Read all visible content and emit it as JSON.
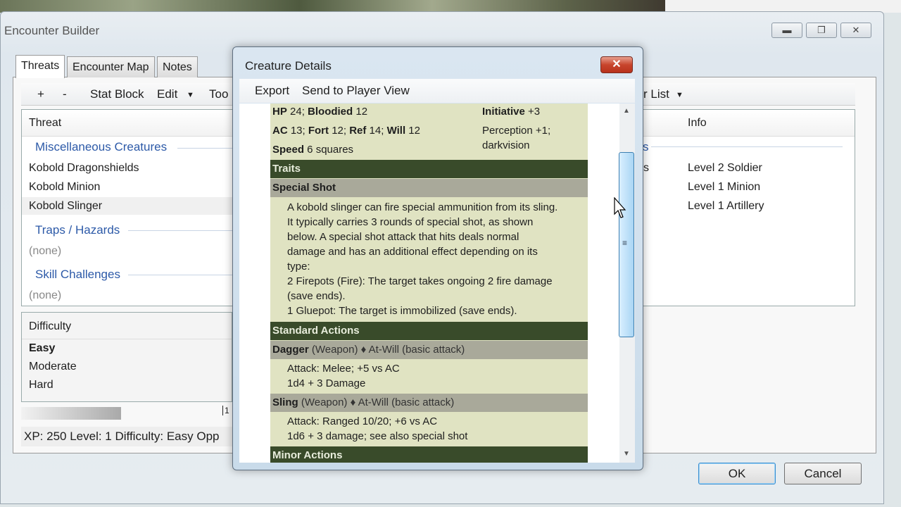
{
  "main_window": {
    "title": "Encounter Builder",
    "min": "▬",
    "max": "❐",
    "close": "✕"
  },
  "tabs": [
    "Threats",
    "Encounter Map",
    "Notes"
  ],
  "toolbar": {
    "add": "+",
    "remove": "-",
    "stat_block": "Stat Block",
    "edit": "Edit",
    "tools": "Too",
    "list": "r List"
  },
  "list": {
    "columns": [
      "Threat",
      "Info"
    ],
    "groups": [
      {
        "name": "Miscellaneous Creatures",
        "suffix": "s"
      },
      {
        "name": "Traps / Hazards"
      },
      {
        "name": "Skill Challenges"
      }
    ],
    "rows": [
      {
        "name": "Kobold Dragonshields",
        "suffix": "s",
        "info": "Level 2 Soldier"
      },
      {
        "name": "Kobold Minion",
        "info": "Level 1 Minion"
      },
      {
        "name": "Kobold Slinger",
        "info": "Level 1 Artillery"
      }
    ],
    "none": "(none)"
  },
  "difficulty": {
    "header": "Difficulty",
    "options": [
      "Easy",
      "Moderate",
      "Hard"
    ],
    "selected": "Easy",
    "marker": "1"
  },
  "status": "XP: 250   Level: 1   Difficulty: Easy   Opp",
  "buttons": {
    "ok": "OK",
    "cancel": "Cancel"
  },
  "dialog": {
    "title": "Creature Details",
    "close": "✕",
    "export": "Export",
    "send": "Send to Player View",
    "stats": {
      "hp_l": "HP",
      "hp": " 24; ",
      "bl_l": "Bloodied",
      "bl": " 12",
      "ac_l": "AC",
      "ac": " 13; ",
      "fort_l": "Fort",
      "fort": " 12; ",
      "ref_l": "Ref",
      "ref": " 14; ",
      "will_l": "Will",
      "will": " 12",
      "speed_l": "Speed",
      "speed": " 6 squares",
      "init_l": "Initiative",
      "init": " +3",
      "perception": "Perception +1; darkvision"
    },
    "traits": "Traits",
    "special_shot": "Special Shot",
    "special_text": [
      "A kobold slinger can fire special ammunition from its sling.",
      "It typically carries 3 rounds of special shot, as shown",
      "below. A special shot attack that hits deals normal",
      "damage and has an additional effect depending on its",
      "type:",
      "2 Firepots (Fire): The target takes ongoing 2 fire damage",
      "(save ends).",
      "1 Gluepot: The target is immobilized (save ends)."
    ],
    "standard": "Standard Actions",
    "dagger": {
      "name": "Dagger",
      "tail": " (Weapon) ♦ At-Will (basic attack)",
      "lines": [
        "Attack: Melee; +5 vs AC",
        "1d4 + 3 Damage"
      ]
    },
    "sling": {
      "name": "Sling",
      "tail": " (Weapon) ♦ At-Will (basic attack)",
      "lines": [
        "Attack: Ranged 10/20; +6 vs AC",
        "1d6 + 3 damage; see also special shot"
      ]
    },
    "minor": "Minor Actions"
  },
  "colors": {
    "header": "#394b2a",
    "subheader": "#a9a99a",
    "body": "#e0e3c2",
    "group": "#2d5aa8"
  }
}
